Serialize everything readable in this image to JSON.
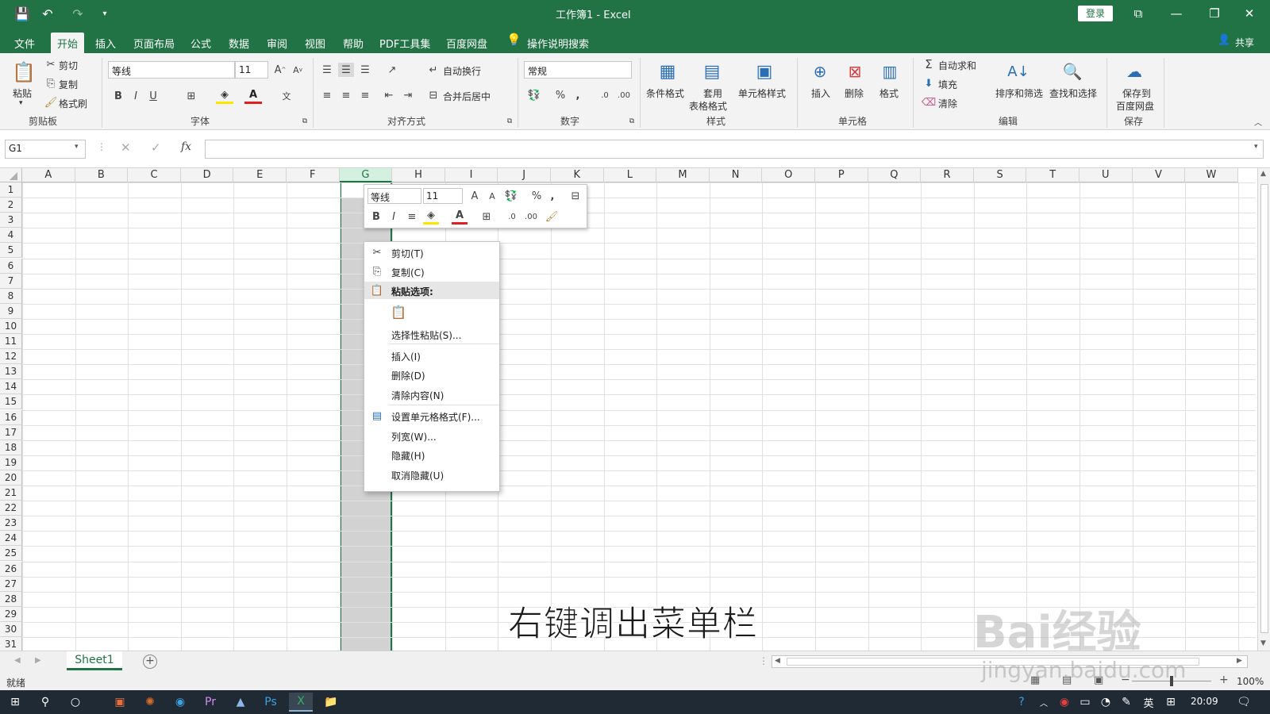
{
  "title": {
    "text": "工作簿1 - Excel",
    "login": "登录"
  },
  "tabs": [
    "文件",
    "开始",
    "插入",
    "页面布局",
    "公式",
    "数据",
    "审阅",
    "视图",
    "帮助",
    "PDF工具集",
    "百度网盘"
  ],
  "search_hint": "操作说明搜索",
  "share": "共享",
  "ribbon": {
    "clipboard": {
      "paste": "粘贴",
      "cut": "剪切",
      "copy": "复制",
      "format_painter": "格式刷",
      "label": "剪贴板"
    },
    "font": {
      "name": "等线",
      "size": "11",
      "label": "字体"
    },
    "alignment": {
      "wrap": "自动换行",
      "merge": "合并后居中",
      "label": "对齐方式"
    },
    "number": {
      "format": "常规",
      "label": "数字"
    },
    "styles": {
      "cond": "条件格式",
      "table1": "套用",
      "table2": "表格格式",
      "cell": "单元格样式",
      "label": "样式"
    },
    "cells": {
      "insert": "插入",
      "delete": "删除",
      "format": "格式",
      "label": "单元格"
    },
    "editing": {
      "autosum": "自动求和",
      "fill": "填充",
      "clear": "清除",
      "sort": "排序和筛选",
      "find": "查找和选择",
      "label": "编辑"
    },
    "save": {
      "line1": "保存到",
      "line2": "百度网盘",
      "label": "保存"
    }
  },
  "formula_bar": {
    "name_box": "G1",
    "fx": "fx",
    "value": ""
  },
  "columns": [
    "A",
    "B",
    "C",
    "D",
    "E",
    "F",
    "G",
    "H",
    "I",
    "J",
    "K",
    "L",
    "M",
    "N",
    "O",
    "P",
    "Q",
    "R",
    "S",
    "T",
    "U",
    "V",
    "W"
  ],
  "rows": [
    "1",
    "2",
    "3",
    "4",
    "5",
    "6",
    "7",
    "8",
    "9",
    "10",
    "11",
    "12",
    "13",
    "14",
    "15",
    "16",
    "17",
    "18",
    "19",
    "20",
    "21",
    "22",
    "23",
    "24",
    "25",
    "26",
    "27",
    "28",
    "29",
    "30",
    "31"
  ],
  "mini_toolbar": {
    "font": "等线",
    "size": "11"
  },
  "context_menu": {
    "cut": "剪切(T)",
    "copy": "复制(C)",
    "paste_options": "粘贴选项:",
    "paste_special": "选择性粘贴(S)...",
    "insert": "插入(I)",
    "delete": "删除(D)",
    "clear": "清除内容(N)",
    "format_cells": "设置单元格格式(F)...",
    "col_width": "列宽(W)...",
    "hide": "隐藏(H)",
    "unhide": "取消隐藏(U)"
  },
  "sheet_tab": "Sheet1",
  "status": {
    "ready": "就绪",
    "zoom": "100%"
  },
  "taskbar": {
    "time": "20:09",
    "lang": "英"
  },
  "caption": "右键调出菜单栏",
  "watermark": {
    "brand": "Bai经验",
    "url": "jingyan.baidu.com"
  },
  "colors": {
    "excel_green": "#217346",
    "selected_col": "#d2d2d2"
  }
}
